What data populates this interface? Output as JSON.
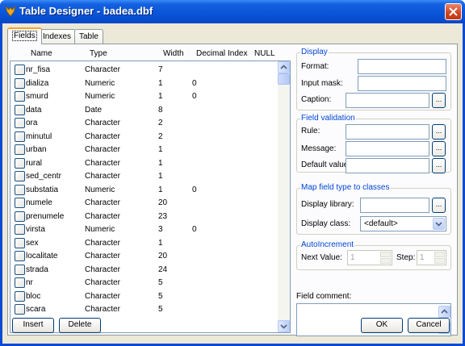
{
  "window": {
    "title": "Table Designer - badea.dbf",
    "title_icon": "fox-icon"
  },
  "tabs": [
    {
      "label": "Fields",
      "active": true
    },
    {
      "label": "Indexes",
      "active": false
    },
    {
      "label": "Table",
      "active": false
    }
  ],
  "grid": {
    "columns": [
      "Name",
      "Type",
      "Width",
      "Decimal",
      "Index",
      "NULL"
    ],
    "rows": [
      {
        "name": "nr_fisa",
        "type": "Character",
        "width": "7",
        "decimal": ""
      },
      {
        "name": "dializa",
        "type": "Numeric",
        "width": "1",
        "decimal": "0"
      },
      {
        "name": "smurd",
        "type": "Numeric",
        "width": "1",
        "decimal": "0"
      },
      {
        "name": "data",
        "type": "Date",
        "width": "8",
        "decimal": ""
      },
      {
        "name": "ora",
        "type": "Character",
        "width": "2",
        "decimal": ""
      },
      {
        "name": "minutul",
        "type": "Character",
        "width": "2",
        "decimal": ""
      },
      {
        "name": "urban",
        "type": "Character",
        "width": "1",
        "decimal": ""
      },
      {
        "name": "rural",
        "type": "Character",
        "width": "1",
        "decimal": ""
      },
      {
        "name": "sed_centr",
        "type": "Character",
        "width": "1",
        "decimal": ""
      },
      {
        "name": "substatia",
        "type": "Numeric",
        "width": "1",
        "decimal": "0"
      },
      {
        "name": "numele",
        "type": "Character",
        "width": "20",
        "decimal": ""
      },
      {
        "name": "prenumele",
        "type": "Character",
        "width": "23",
        "decimal": ""
      },
      {
        "name": "virsta",
        "type": "Numeric",
        "width": "3",
        "decimal": "0"
      },
      {
        "name": "sex",
        "type": "Character",
        "width": "1",
        "decimal": ""
      },
      {
        "name": "localitate",
        "type": "Character",
        "width": "20",
        "decimal": ""
      },
      {
        "name": "strada",
        "type": "Character",
        "width": "24",
        "decimal": ""
      },
      {
        "name": "nr",
        "type": "Character",
        "width": "5",
        "decimal": ""
      },
      {
        "name": "bloc",
        "type": "Character",
        "width": "5",
        "decimal": ""
      },
      {
        "name": "scara",
        "type": "Character",
        "width": "5",
        "decimal": ""
      }
    ]
  },
  "display": {
    "legend": "Display",
    "format_label": "Format:",
    "input_mask_label": "Input mask:",
    "caption_label": "Caption:",
    "ellipsis": "..."
  },
  "field_validation": {
    "legend": "Field validation",
    "rule_label": "Rule:",
    "message_label": "Message:",
    "default_label": "Default value:"
  },
  "map_field": {
    "legend": "Map field type to classes",
    "display_library_label": "Display library:",
    "display_class_label": "Display class:",
    "display_class_value": "<default>"
  },
  "autoincrement": {
    "legend": "AutoIncrement",
    "next_value_label": "Next Value:",
    "next_value": "1",
    "step_label": "Step:",
    "step_value": "1"
  },
  "field_comment_label": "Field comment:",
  "buttons": {
    "insert": "Insert",
    "delete": "Delete",
    "ok": "OK",
    "cancel": "Cancel"
  }
}
